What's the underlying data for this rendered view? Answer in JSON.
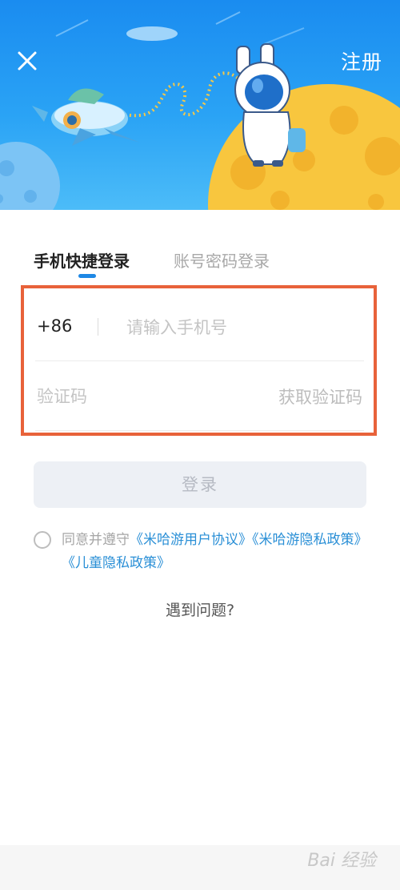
{
  "header": {
    "register_label": "注册",
    "close_icon": "close-icon",
    "colors": {
      "sky": "#1a8cf0",
      "moon": "#f8c63e",
      "planet": "#7cc4f5"
    }
  },
  "tabs": [
    {
      "label": "手机快捷登录",
      "active": true
    },
    {
      "label": "账号密码登录",
      "active": false
    }
  ],
  "form": {
    "country_code": "+86",
    "phone_placeholder": "请输入手机号",
    "code_placeholder": "验证码",
    "get_code_label": "获取验证码"
  },
  "login_button": {
    "label": "登录"
  },
  "agreement": {
    "prefix": "同意并遵守",
    "link1": "《米哈游用户协议》",
    "link2": "《米哈游隐私政策》",
    "link3": "《儿童隐私政策》"
  },
  "help": {
    "label": "遇到问题?"
  },
  "watermark": {
    "text": "Bai 经验"
  }
}
